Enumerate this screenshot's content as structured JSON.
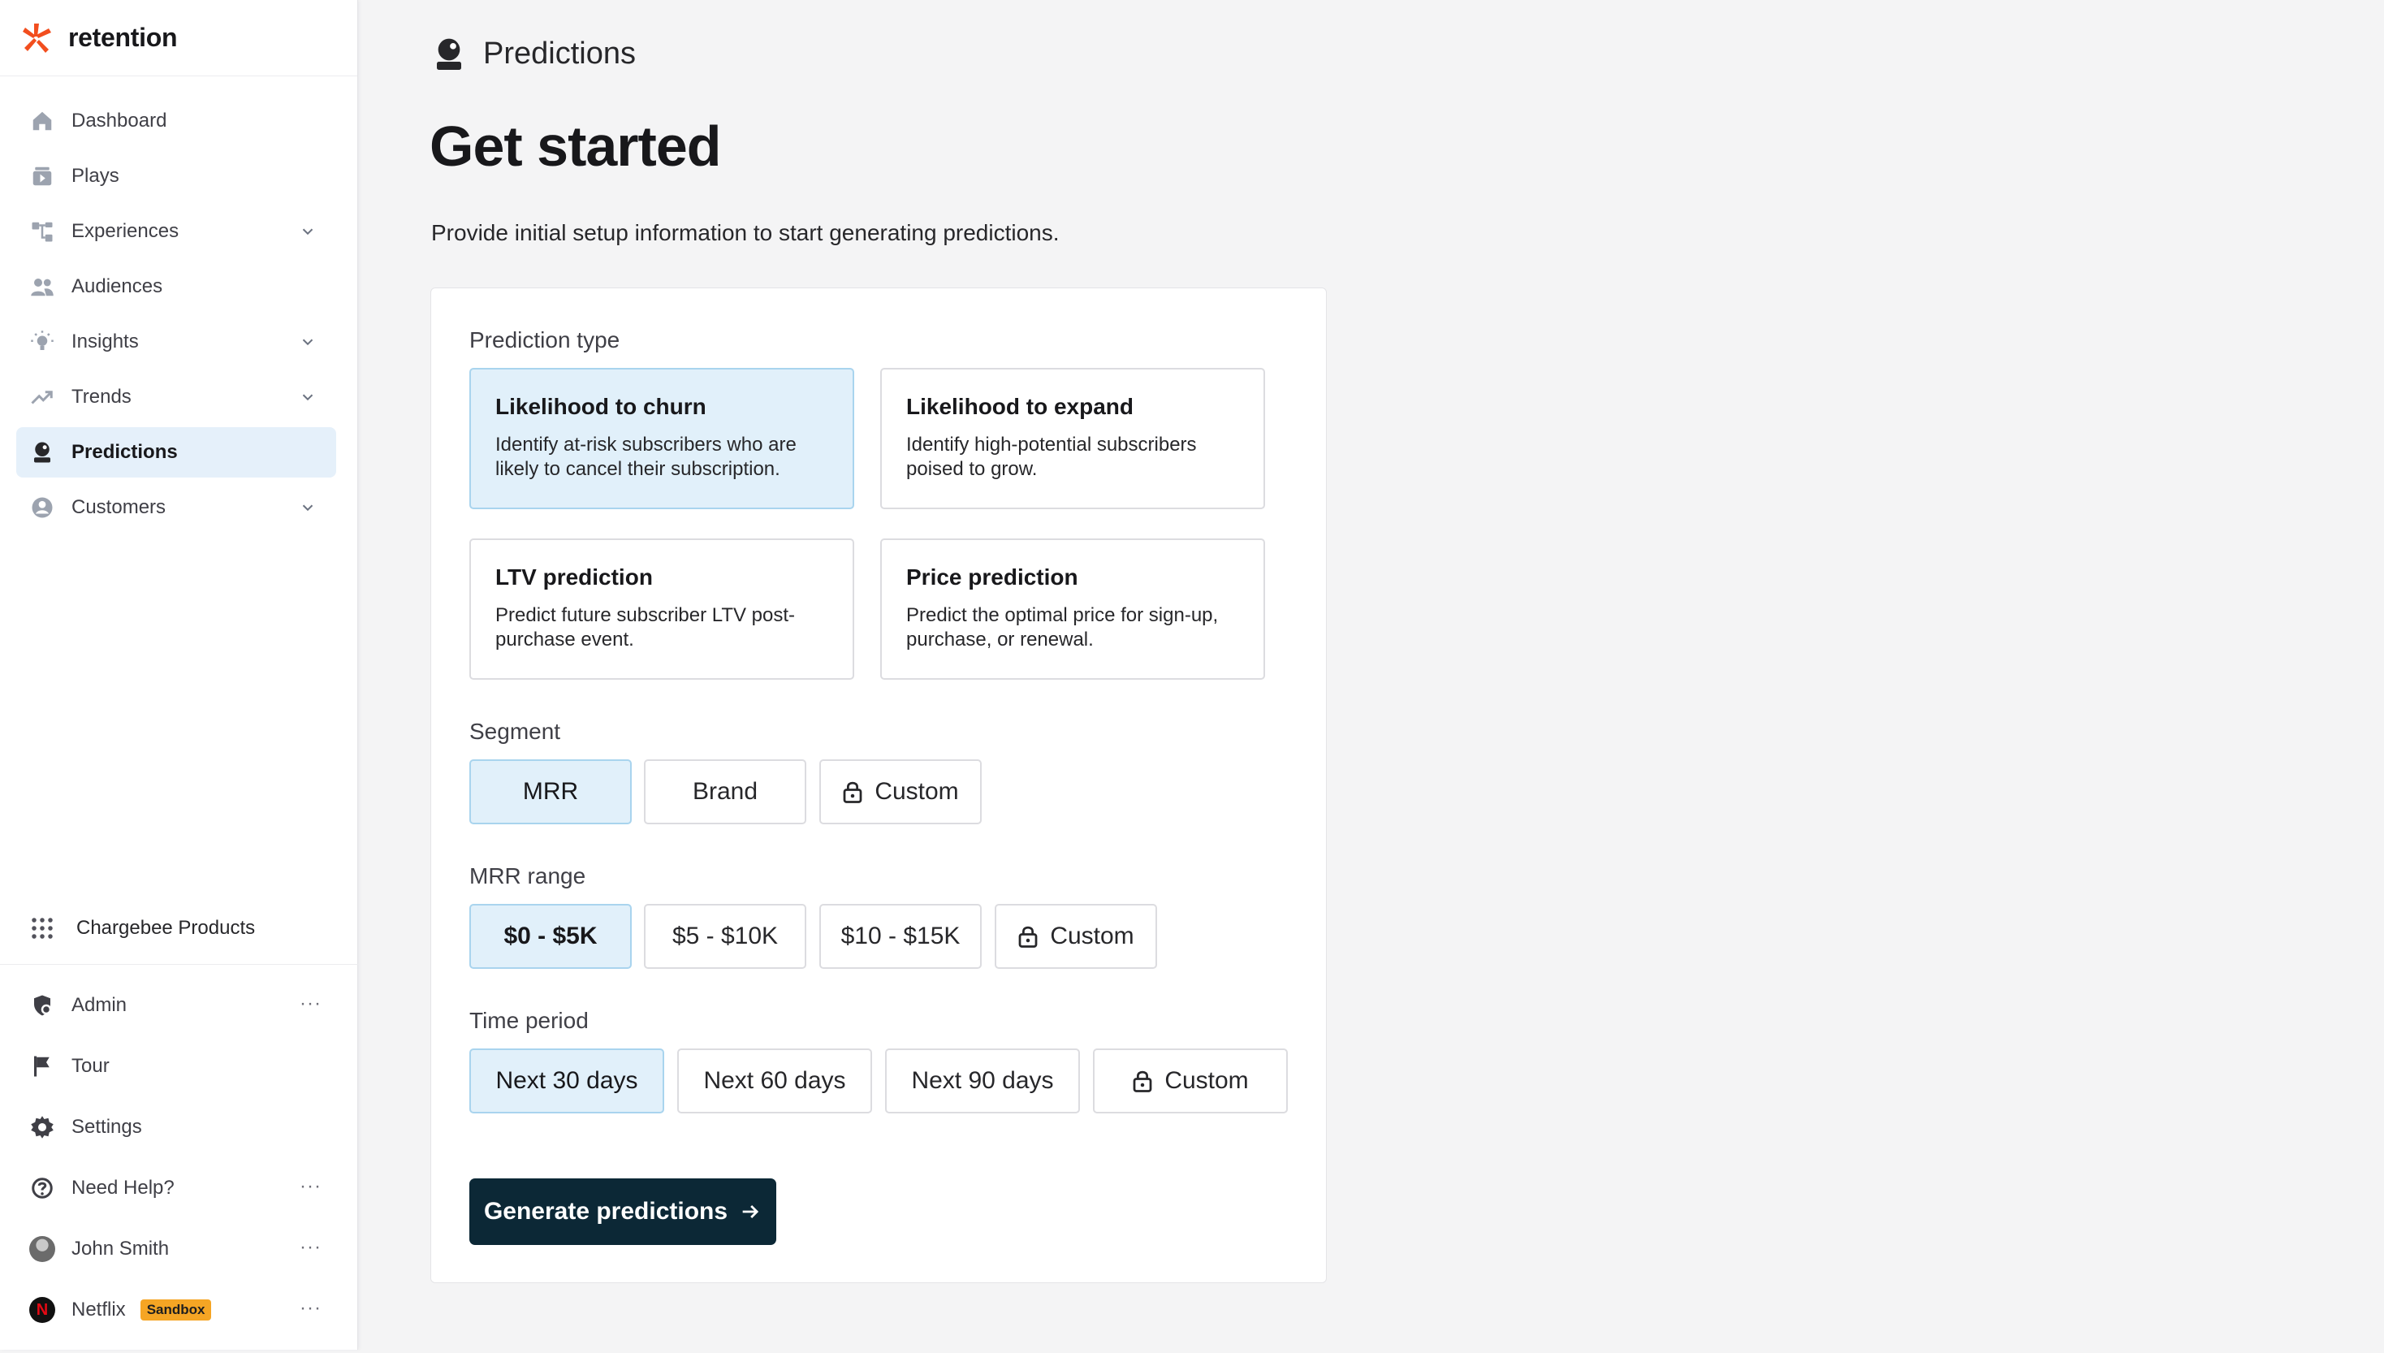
{
  "brand": {
    "name": "retention",
    "accent": "#f24e1e"
  },
  "sidebar": {
    "items": [
      {
        "label": "Dashboard",
        "icon": "home-icon"
      },
      {
        "label": "Plays",
        "icon": "plays-icon"
      },
      {
        "label": "Experiences",
        "icon": "experiences-icon",
        "expandable": true
      },
      {
        "label": "Audiences",
        "icon": "users-icon"
      },
      {
        "label": "Insights",
        "icon": "lightbulb-icon",
        "expandable": true
      },
      {
        "label": "Trends",
        "icon": "trend-up-icon",
        "expandable": true
      },
      {
        "label": "Predictions",
        "icon": "predictions-icon",
        "active": true
      },
      {
        "label": "Customers",
        "icon": "user-circle-icon",
        "expandable": true
      }
    ],
    "products_label": "Chargebee Products",
    "bottom": {
      "admin": "Admin",
      "tour": "Tour",
      "settings": "Settings",
      "help": "Need Help?",
      "user": "John Smith",
      "account": "Netflix",
      "account_badge": "Sandbox"
    }
  },
  "header": {
    "title": "Predictions",
    "icon": "predictions-icon"
  },
  "main": {
    "title": "Get started",
    "subtitle": "Provide initial setup information to start generating predictions."
  },
  "form": {
    "prediction_type_label": "Prediction type",
    "types": [
      {
        "title": "Likelihood to churn",
        "desc": "Identify at-risk subscribers who are likely to cancel their subscription.",
        "selected": true
      },
      {
        "title": "Likelihood to expand",
        "desc": "Identify high-potential subscribers poised to grow."
      },
      {
        "title": "LTV prediction",
        "desc": "Predict future subscriber LTV post-purchase event."
      },
      {
        "title": "Price prediction",
        "desc": "Predict the optimal price for sign-up, purchase, or renewal."
      }
    ],
    "segment_label": "Segment",
    "segments": [
      "MRR",
      "Brand",
      "Custom"
    ],
    "mrr_label": "MRR range",
    "mrr_ranges": [
      "$0 - $5K",
      "$5 - $10K",
      "$10 - $15K",
      "Custom"
    ],
    "time_label": "Time period",
    "time_periods": [
      "Next 30 days",
      "Next 60 days",
      "Next 90 days",
      "Custom"
    ],
    "cta_label": "Generate predictions"
  },
  "colors": {
    "selected_bg": "#e1f0fa",
    "cta_bg": "#0c2836",
    "badge": "#f5a524"
  }
}
